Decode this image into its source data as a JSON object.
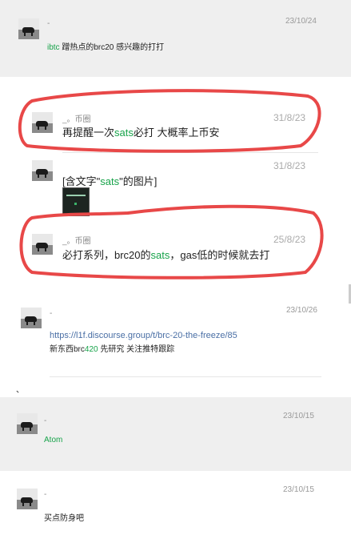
{
  "messages": {
    "m1": {
      "name": "-",
      "date": "23/10/24",
      "pre": "ibtc",
      "text": "蹭热点的brc20  感兴趣的打打"
    },
    "q1": {
      "name": "_。币圈",
      "date": "31/8/23",
      "pre": "再提醒一次",
      "hl": "sats",
      "post": "必打  大概率上币安"
    },
    "q2": {
      "name": "",
      "date": "31/8/23",
      "pre": "[含文字\"",
      "hl": "sats",
      "post": "\"的图片]"
    },
    "q3": {
      "name": "_。币圈",
      "date": "25/8/23",
      "pre": "必打系列，brc20的",
      "hl": "sats",
      "post": "，gas低的时候就去打"
    },
    "m2": {
      "name": "-",
      "date": "23/10/26",
      "link": "https://l1f.discourse.group/t/brc-20-the-freeze/85",
      "pre": "新东西brc",
      "hl": "420",
      "post": "  先研究  关注推特跟踪"
    },
    "stray": "、",
    "m3": {
      "name": "-",
      "date": "23/10/15",
      "text": "Atom"
    },
    "m4": {
      "name": "-",
      "date": "23/10/15",
      "text": "买点防身吧"
    }
  },
  "colors": {
    "highlight": "#17a34a",
    "annotation": "#e84848",
    "gray_bg": "#efefef"
  }
}
